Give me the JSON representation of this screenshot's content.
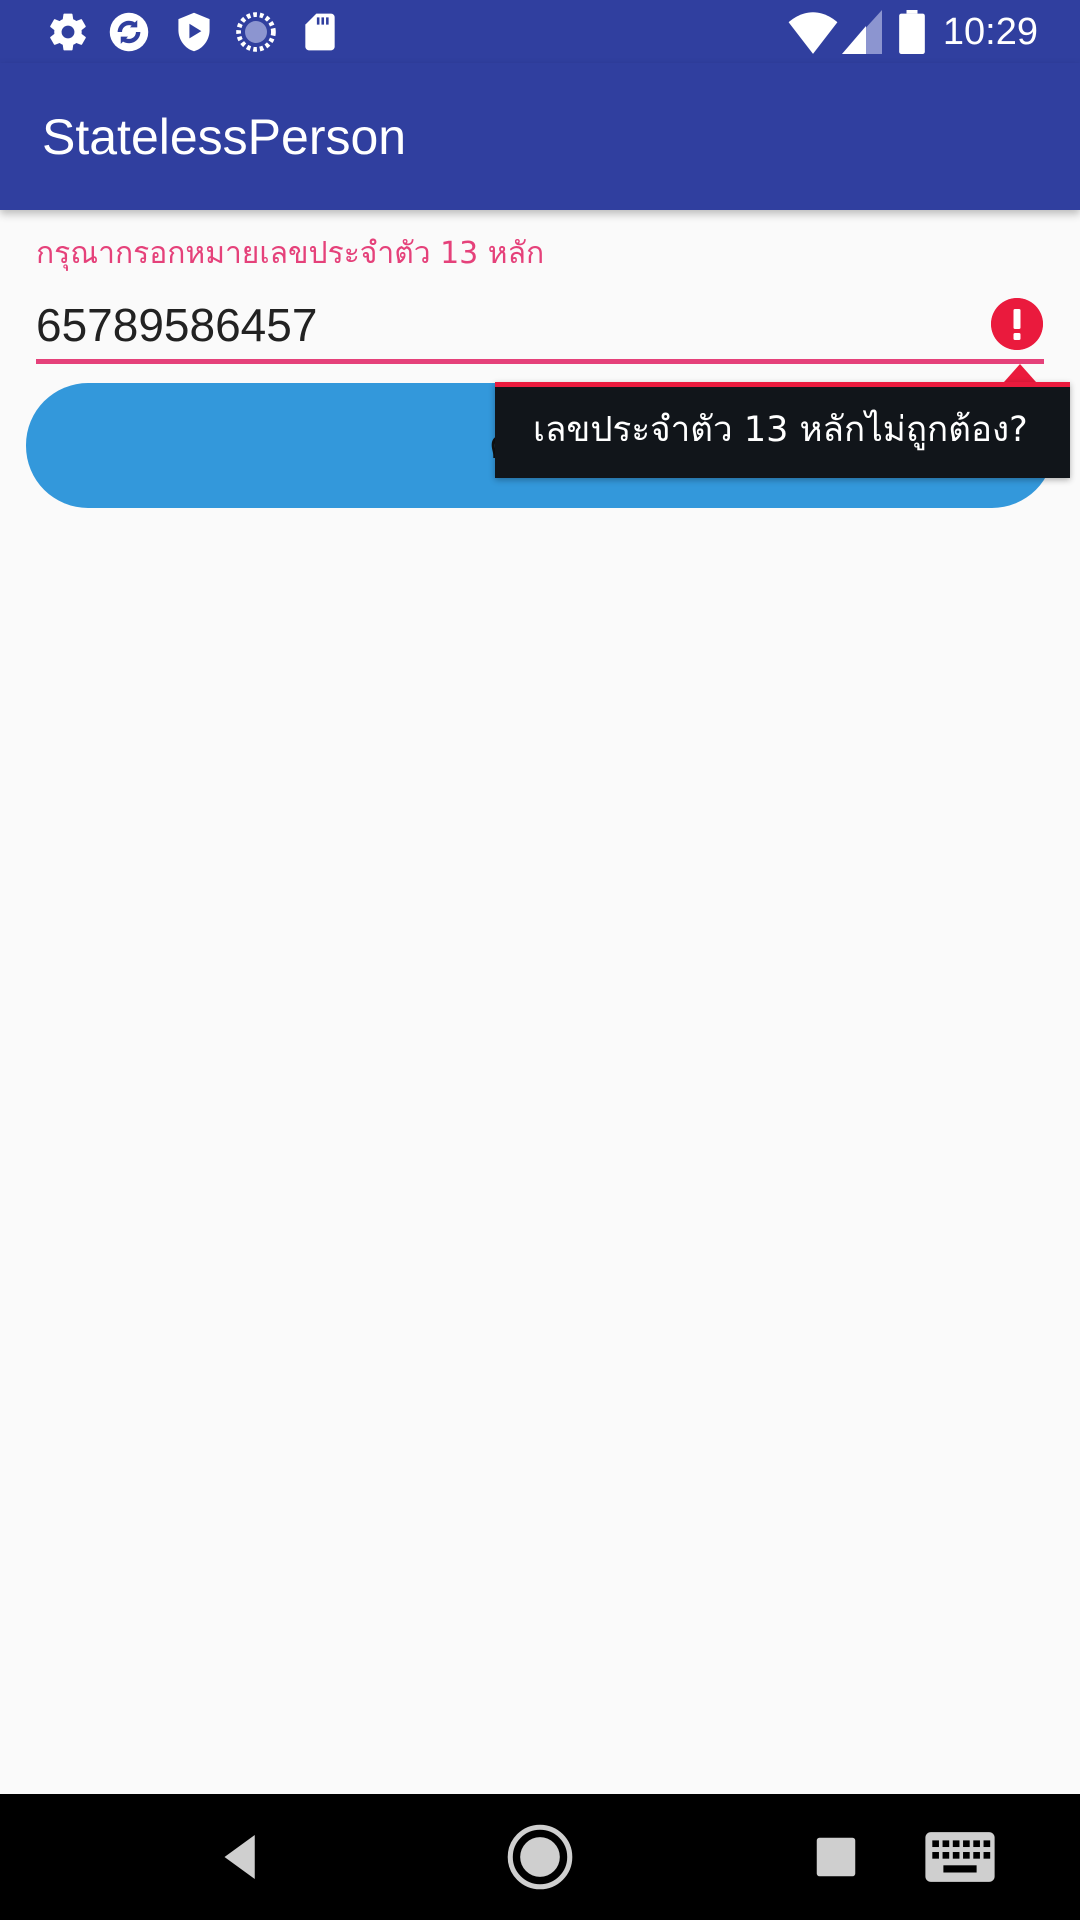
{
  "status_bar": {
    "time": "10:29",
    "left_icons": [
      "settings-icon",
      "sync-icon",
      "shield-play-icon",
      "progress-icon",
      "sd-card-icon"
    ],
    "right_icons": [
      "wifi-icon",
      "cellular-signal-icon",
      "battery-icon"
    ]
  },
  "app_bar": {
    "title": "StatelessPerson"
  },
  "form": {
    "hint": "กรุณากรอกหมายเลขประจำตัว 13 หลัก",
    "id_value": "65789586457",
    "search_button_label": "ค้นหา",
    "error_message": "เลขประจำตัว 13 หลักไม่ถูกต้อง?"
  },
  "colors": {
    "primary": "#303f9f",
    "accent": "#e5417a",
    "error": "#ea1a3d",
    "button": "#3398db",
    "background": "#fafafa"
  },
  "nav_bar": {
    "buttons": [
      "back-icon",
      "home-icon",
      "recents-icon",
      "keyboard-icon"
    ]
  }
}
